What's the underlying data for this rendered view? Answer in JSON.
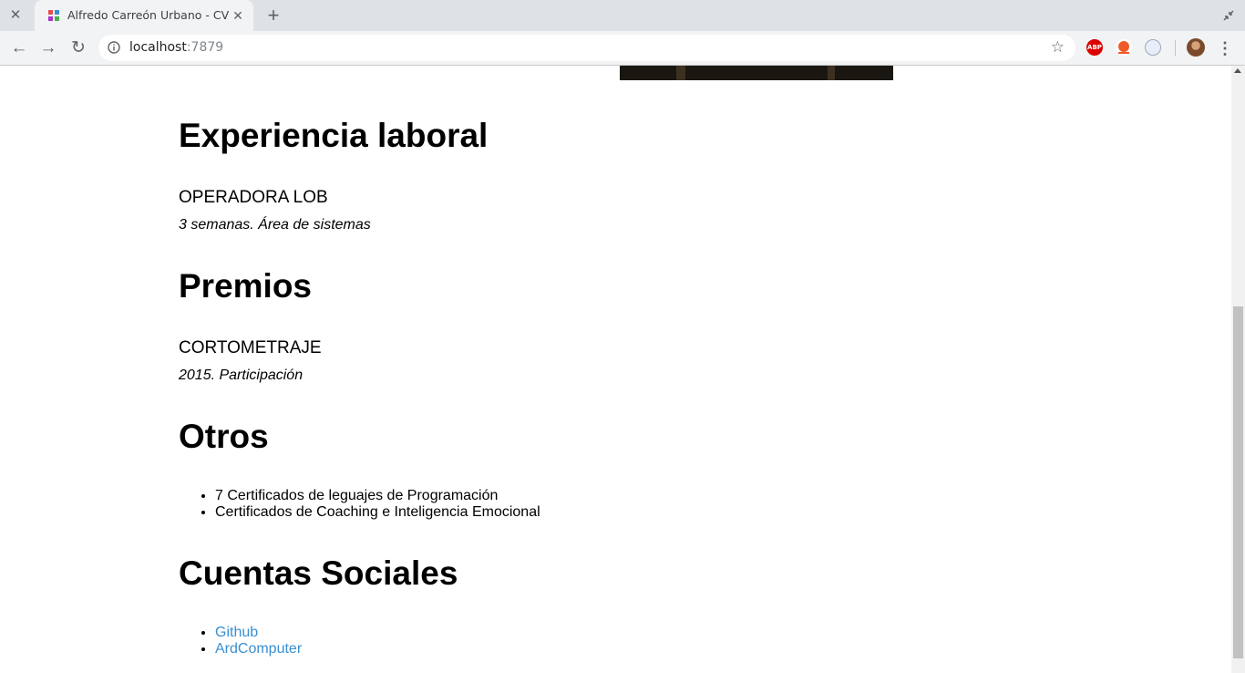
{
  "browser": {
    "tab_title": "Alfredo Carreón Urbano - CV",
    "url_host": "localhost",
    "url_port": ":7879",
    "extensions": [
      "ABP"
    ]
  },
  "cv": {
    "experience": {
      "heading": "Experiencia laboral",
      "job_title": "OPERADORA LOB",
      "job_detail": "3 semanas. Área de sistemas"
    },
    "awards": {
      "heading": "Premios",
      "award_title": "CORTOMETRAJE",
      "award_detail": "2015. Participación"
    },
    "others": {
      "heading": "Otros",
      "items": [
        "7 Certificados de leguajes de Programación",
        "Certificados de Coaching e Inteligencia Emocional"
      ]
    },
    "social": {
      "heading": "Cuentas Sociales",
      "links": [
        "Github",
        "ArdComputer"
      ],
      "link_color": "#3a8fd1"
    }
  }
}
